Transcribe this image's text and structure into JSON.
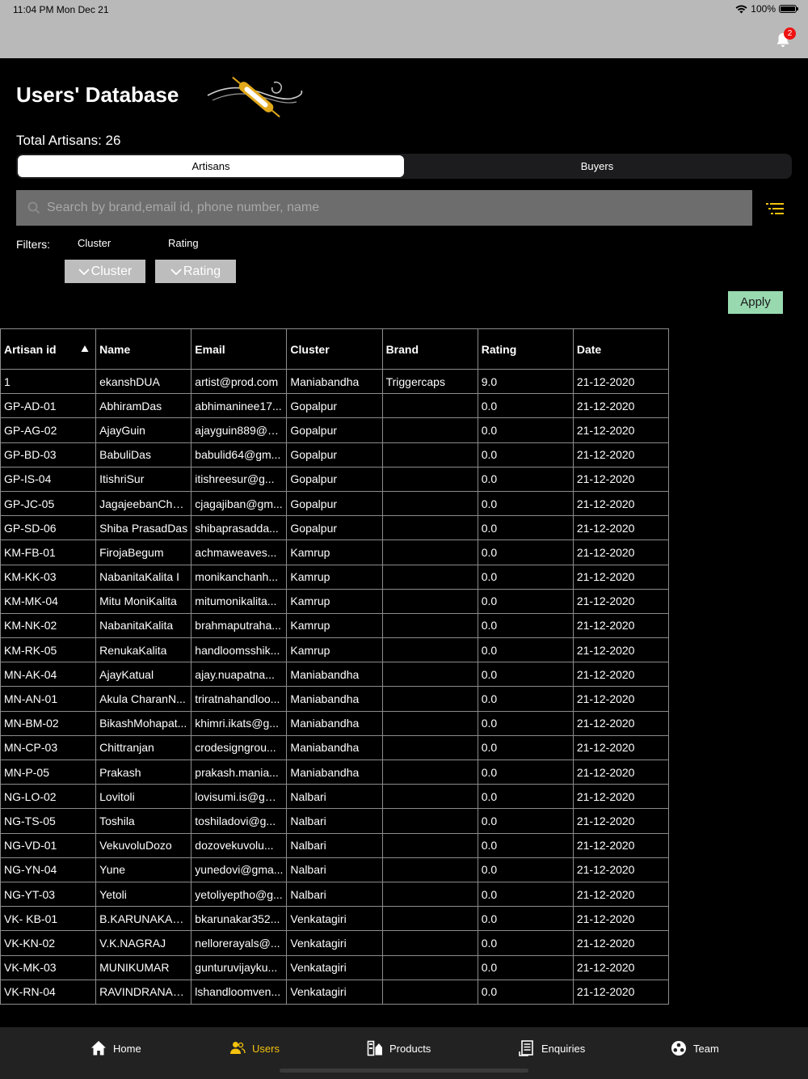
{
  "status": {
    "time": "11:04 PM   Mon Dec 21",
    "battery": "100%",
    "notification_count": "2"
  },
  "header": {
    "title": "Users' Database",
    "total": "Total Artisans: 26"
  },
  "segments": {
    "artisans": "Artisans",
    "buyers": "Buyers",
    "active": "Artisans"
  },
  "search": {
    "placeholder": "Search by brand,email id, phone number, name"
  },
  "filters": {
    "label": "Filters:",
    "cluster_label": "Cluster",
    "rating_label": "Rating",
    "cluster_value": "Cluster",
    "rating_value": "Rating",
    "apply": "Apply"
  },
  "table": {
    "columns": [
      "Artisan id",
      "Name",
      "Email",
      "Cluster",
      "Brand",
      "Rating",
      "Date"
    ],
    "rows": [
      [
        "1",
        "ekanshDUA",
        "artist@prod.com",
        "Maniabandha",
        "Triggercaps",
        "9.0",
        "21-12-2020"
      ],
      [
        "GP-AD-01",
        "AbhiramDas",
        "abhimaninee17...",
        "Gopalpur",
        "",
        "0.0",
        "21-12-2020"
      ],
      [
        "GP-AG-02",
        "AjayGuin",
        "ajayguin889@g...",
        "Gopalpur",
        "",
        "0.0",
        "21-12-2020"
      ],
      [
        "GP-BD-03",
        "BabuliDas",
        "babulid64@gm...",
        "Gopalpur",
        "",
        "0.0",
        "21-12-2020"
      ],
      [
        "GP-IS-04",
        "ItishriSur",
        "itishreesur@g...",
        "Gopalpur",
        "",
        "0.0",
        "21-12-2020"
      ],
      [
        "GP-JC-05",
        "JagajeebanCha...",
        "cjagajiban@gm...",
        "Gopalpur",
        "",
        "0.0",
        "21-12-2020"
      ],
      [
        "GP-SD-06",
        "Shiba PrasadDas",
        "shibaprasadda...",
        "Gopalpur",
        "",
        "0.0",
        "21-12-2020"
      ],
      [
        "KM-FB-01",
        "FirojaBegum",
        "achmaweaves...",
        "Kamrup",
        "",
        "0.0",
        "21-12-2020"
      ],
      [
        "KM-KK-03",
        "NabanitaKalita I",
        "monikanchanh...",
        "Kamrup",
        "",
        "0.0",
        "21-12-2020"
      ],
      [
        "KM-MK-04",
        "Mitu MoniKalita",
        "mitumonikalita...",
        "Kamrup",
        "",
        "0.0",
        "21-12-2020"
      ],
      [
        "KM-NK-02",
        "NabanitaKalita",
        "brahmaputraha...",
        "Kamrup",
        "",
        "0.0",
        "21-12-2020"
      ],
      [
        "KM-RK-05",
        "RenukaKalita",
        "handloomsshik...",
        "Kamrup",
        "",
        "0.0",
        "21-12-2020"
      ],
      [
        "MN-AK-04",
        "AjayKatual",
        "ajay.nuapatna...",
        "Maniabandha",
        "",
        "0.0",
        "21-12-2020"
      ],
      [
        "MN-AN-01",
        "Akula CharanN...",
        "triratnahandloo...",
        "Maniabandha",
        "",
        "0.0",
        "21-12-2020"
      ],
      [
        "MN-BM-02",
        "BikashMohapat...",
        "khimri.ikats@g...",
        "Maniabandha",
        "",
        "0.0",
        "21-12-2020"
      ],
      [
        "MN-CP-03",
        "Chittranjan",
        "crodesigngrou...",
        "Maniabandha",
        "",
        "0.0",
        "21-12-2020"
      ],
      [
        "MN-P-05",
        "Prakash",
        "prakash.mania...",
        "Maniabandha",
        "",
        "0.0",
        "21-12-2020"
      ],
      [
        "NG-LO-02",
        "Lovitoli",
        "lovisumi.is@gm...",
        "Nalbari",
        "",
        "0.0",
        "21-12-2020"
      ],
      [
        "NG-TS-05",
        "Toshila",
        "toshiladovi@g...",
        "Nalbari",
        "",
        "0.0",
        "21-12-2020"
      ],
      [
        "NG-VD-01",
        "VekuvoluDozo",
        " dozovekuvolu...",
        "Nalbari",
        "",
        "0.0",
        "21-12-2020"
      ],
      [
        "NG-YN-04",
        "Yune",
        "yunedovi@gma...",
        "Nalbari",
        "",
        "0.0",
        "21-12-2020"
      ],
      [
        "NG-YT-03",
        "Yetoli",
        "yetoliyeptho@g...",
        "Nalbari",
        "",
        "0.0",
        "21-12-2020"
      ],
      [
        "VK- KB-01",
        "B.KARUNAKAR...",
        "bkarunakar352...",
        "Venkatagiri",
        "",
        "0.0",
        "21-12-2020"
      ],
      [
        "VK-KN-02",
        "V.K.NAGRAJ",
        "nellorerayals@...",
        "Venkatagiri",
        "",
        "0.0",
        "21-12-2020"
      ],
      [
        "VK-MK-03",
        "MUNIKUMAR",
        "gunturuvijayku...",
        "Venkatagiri",
        "",
        "0.0",
        "21-12-2020"
      ],
      [
        "VK-RN-04",
        "RAVINDRANALLI",
        "lshandloomven...",
        "Venkatagiri",
        "",
        "0.0",
        "21-12-2020"
      ]
    ]
  },
  "tabs": [
    {
      "label": "Home",
      "icon": "house-icon",
      "active": false
    },
    {
      "label": "Users",
      "icon": "users-icon",
      "active": true
    },
    {
      "label": "Products",
      "icon": "products-icon",
      "active": false
    },
    {
      "label": "Enquiries",
      "icon": "enquiries-icon",
      "active": false
    },
    {
      "label": "Team",
      "icon": "team-icon",
      "active": false
    }
  ],
  "colors": {
    "accent": "#f4c20d",
    "apply_bg": "#98d9b0",
    "search_bg": "#6d6d6d",
    "dropdown_bg": "#bdbdbd"
  }
}
